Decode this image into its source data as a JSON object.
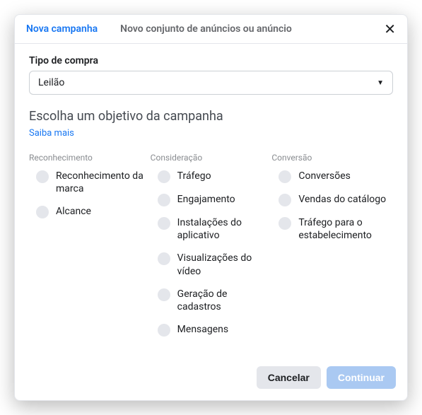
{
  "tabs": {
    "new_campaign": "Nova campanha",
    "new_adset": "Novo conjunto de anúncios ou anúncio"
  },
  "buying": {
    "label": "Tipo de compra",
    "value": "Leilão"
  },
  "objective": {
    "heading": "Escolha um objetivo da campanha",
    "learn_more": "Saiba mais"
  },
  "columns": {
    "awareness": {
      "header": "Reconhecimento",
      "items": [
        "Reconhecimento da marca",
        "Alcance"
      ]
    },
    "consideration": {
      "header": "Consideração",
      "items": [
        "Tráfego",
        "Engajamento",
        "Instalações do aplicativo",
        "Visualizações do vídeo",
        "Geração de cadastros",
        "Mensagens"
      ]
    },
    "conversion": {
      "header": "Conversão",
      "items": [
        "Conversões",
        "Vendas do catálogo",
        "Tráfego para o estabelecimento"
      ]
    }
  },
  "footer": {
    "cancel": "Cancelar",
    "continue": "Continuar"
  }
}
